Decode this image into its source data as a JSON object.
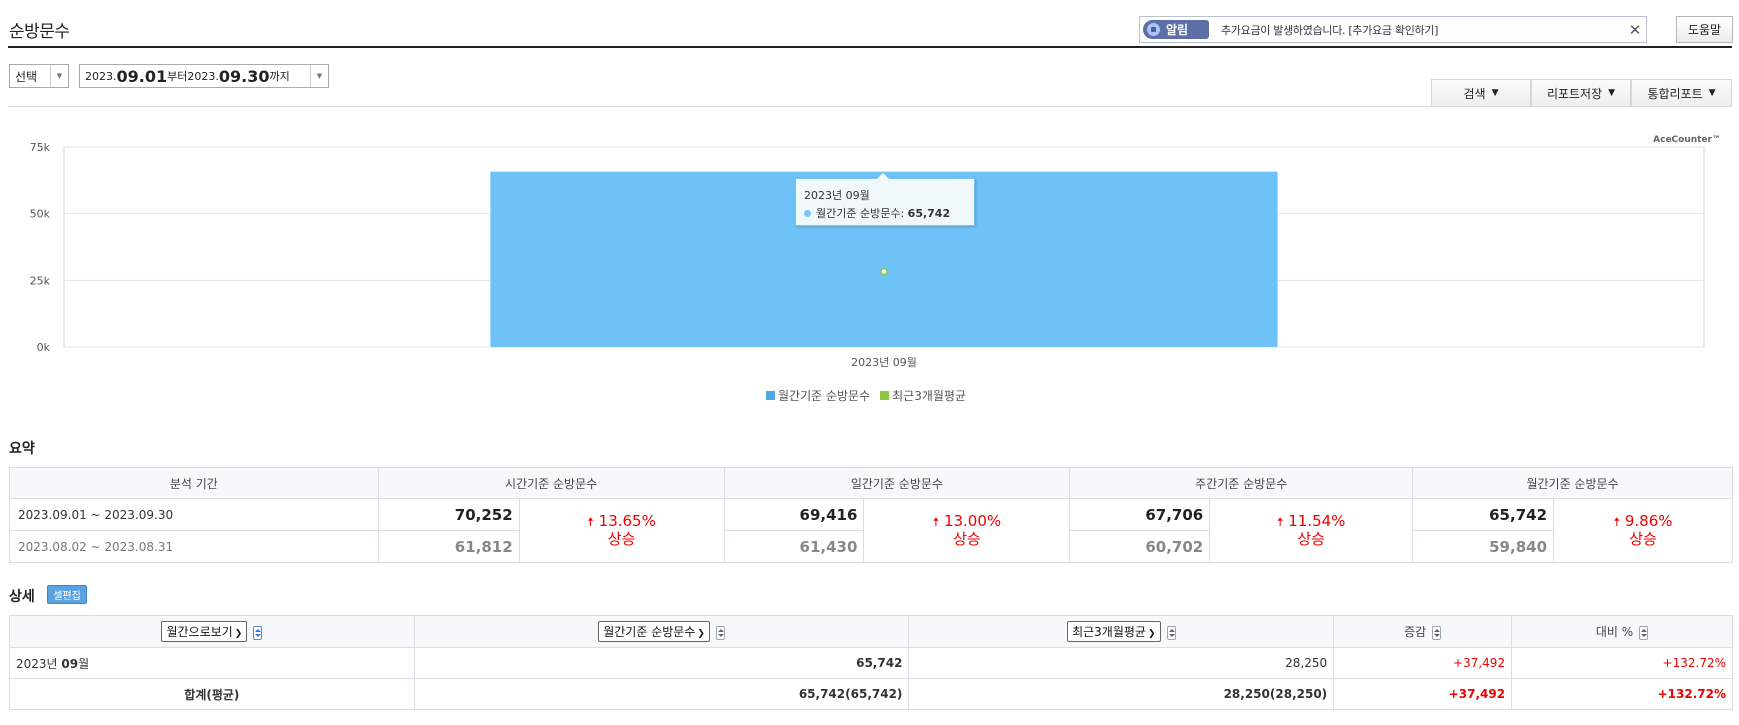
{
  "header": {
    "title": "순방문수",
    "notice_badge": "알림",
    "notice_text": "추가요금이 발생하였습니다. [추가요금 확인하기]",
    "close_glyph": "✕",
    "help_label": "도움말"
  },
  "filters": {
    "type_label": "선택",
    "date_from_year": "2023.",
    "date_from_md": "09.01",
    "date_from_suffix": "부터 ",
    "date_to_year": "2023.",
    "date_to_md": "09.30",
    "date_to_suffix": "까지"
  },
  "toolbar": {
    "search_label": "검색",
    "save_label": "리포트저장",
    "integrated_label": "통합리포트"
  },
  "chart_data": {
    "type": "bar",
    "categories": [
      "2023년 09월"
    ],
    "series": [
      {
        "name": "월간기준 순방문수",
        "values": [
          65742
        ],
        "color": "#6fc2f8"
      },
      {
        "name": "최근3개월평균",
        "values": [
          28250
        ],
        "color": "#8cc63f",
        "display": "point"
      }
    ],
    "ylim": [
      0,
      75000
    ],
    "yticks": [
      0,
      25000,
      50000,
      75000
    ],
    "ytick_labels": [
      "0k",
      "25k",
      "50k",
      "75k"
    ],
    "grid": true,
    "credit": "AceCounter™",
    "legend": [
      {
        "label": "월간기준 순방문수",
        "color": "#4ea8e2"
      },
      {
        "label": "최근3개월평균",
        "color": "#8cc63f"
      }
    ],
    "tooltip": {
      "title": "2023년 09월",
      "label": "월간기준 순방문수: ",
      "value": "65,742"
    }
  },
  "summary": {
    "title": "요약",
    "headers": [
      "분석 기간",
      "시간기준 순방문수",
      "일간기준 순방문수",
      "주간기준 순방문수",
      "월간기준 순방문수"
    ],
    "current_period": "2023.09.01 ~ 2023.09.30",
    "previous_period": "2023.08.02 ~ 2023.08.31",
    "metrics": [
      {
        "current": "70,252",
        "previous": "61,812",
        "change": "13.65%",
        "trend": "상승"
      },
      {
        "current": "69,416",
        "previous": "61,430",
        "change": "13.00%",
        "trend": "상승"
      },
      {
        "current": "67,706",
        "previous": "60,702",
        "change": "11.54%",
        "trend": "상승"
      },
      {
        "current": "65,742",
        "previous": "59,840",
        "change": "9.86%",
        "trend": "상승"
      }
    ]
  },
  "detail": {
    "title": "상세",
    "cell_edit_label": "셀편집",
    "headers": {
      "col1": "월간으로보기",
      "col2": "월간기준 순방문수",
      "col3": "최근3개월평균",
      "col4": "증감",
      "col5": "대비 %"
    },
    "row": {
      "period_prefix": "2023년 ",
      "period_month": "09",
      "period_suffix": "월",
      "value": "65,742",
      "avg": "28,250",
      "delta": "+37,492",
      "ratio": "+132.72%"
    },
    "total": {
      "label": "합계(평균)",
      "value": "65,742(65,742)",
      "avg": "28,250(28,250)",
      "delta": "+37,492",
      "ratio": "+132.72%"
    }
  }
}
